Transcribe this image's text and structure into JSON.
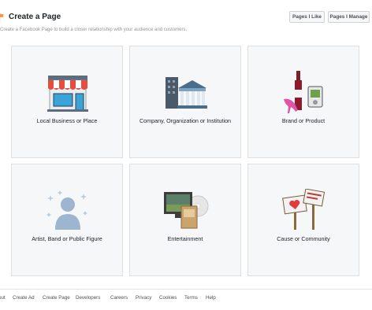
{
  "header": {
    "title": "Create a Page",
    "subtitle": "Create a Facebook Page to build a closer relationship with your audience and customers.",
    "pages_like_label": "Pages I Like",
    "pages_manage_label": "Pages I Manage"
  },
  "categories": [
    {
      "label": "Local Business or Place",
      "icon": "storefront-icon"
    },
    {
      "label": "Company, Organization or Institution",
      "icon": "building-icon"
    },
    {
      "label": "Brand or Product",
      "icon": "product-icon"
    },
    {
      "label": "Artist, Band or Public Figure",
      "icon": "person-icon"
    },
    {
      "label": "Entertainment",
      "icon": "entertainment-icon"
    },
    {
      "label": "Cause or Community",
      "icon": "signs-icon"
    }
  ],
  "footer": {
    "links": [
      "out",
      "Create Ad",
      "Create Page",
      "Developers",
      "Careers",
      "Privacy",
      "Cookies",
      "Terms",
      "Help"
    ]
  },
  "colors": {
    "accent": "#f7923b",
    "card_bg": "#f6f7f9",
    "card_border": "#dddfe2",
    "text": "#1d2129",
    "muted": "#90949c"
  }
}
